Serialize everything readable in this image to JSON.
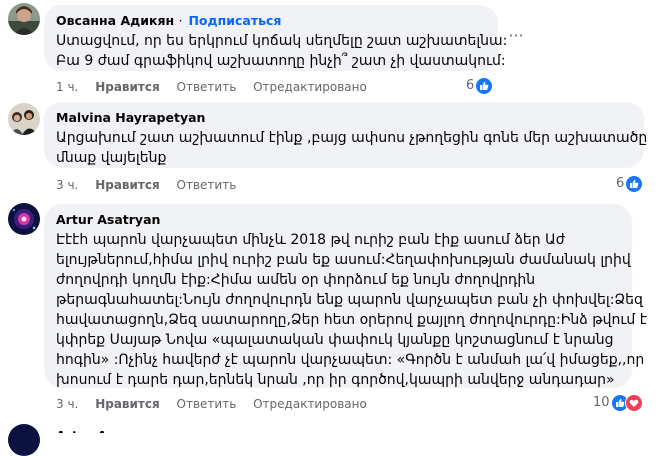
{
  "comments": [
    {
      "author": "Овсанна Адикян",
      "follow_label": "Подписаться",
      "lines": [
        "Ստացվում, որ ես երկրում կոճակ սեղմելը շատ աշխատելնա:",
        "Բա 9 ժամ գրաֆիկով աշխատողը ինչի՞ շատ չի վաստակում:"
      ],
      "time": "1 ч.",
      "like_label": "Нравится",
      "reply_label": "Ответить",
      "edited_label": "Отредактировано",
      "reaction_count": "6",
      "reactions": [
        "like-icon"
      ]
    },
    {
      "author": "Malvina Hayrapetyan",
      "lines": [
        "Արցախում շատ աշխատում էինք ,բայց ափսոս չթողեցին գոնե մեր աշխատածը",
        "մնաք վայելենք"
      ],
      "time": "3 ч.",
      "like_label": "Нравится",
      "reply_label": "Ответить",
      "reaction_count": "6",
      "reactions": [
        "like-icon"
      ]
    },
    {
      "author": "Artur Asatryan",
      "lines": [
        "Էէէհ պարոն վարչապետ մինչև 2018 թվ ուրիշ բան էիք ասում ձեր Աժ",
        "ելույթներում,հիմա լրիվ ուրիշ բան եք ասում:Հեղափոխության ժամանակ լրիվ",
        "ժողովրդի կողմն էիք:Հիմա ամեն օր փորձում եք նույն ժողովրդին",
        "թերագնահատել:Նույն ժողովուրդն ենք պարոն վարչապետ բան չի փոխվել:Ձեզ",
        "հավատացողն,Ձեզ սատարողը,Ձեր հետ օրերով քայլող ժողովուրդը:Ինձ թվում է",
        "կփրեք Սայաթ Նովա  «պալատական փափուկ կյանքը կոշտացնում է նրանց",
        "հոգին» :Ոչինչ հավերժ չէ պարոն վարչապետ: «Գործն է անմահ լա՛վ իմացեք,,որ",
        "խոսում է դարե դար,երնեկ նրան ,որ իր գործով,կապրի անվերջ անդադար»"
      ],
      "time": "3 ч.",
      "like_label": "Нравится",
      "reply_label": "Ответить",
      "edited_label": "Отредактировано",
      "reaction_count": "10",
      "reactions": [
        "like-icon",
        "heart-icon"
      ]
    }
  ],
  "next_author_partial": "Artur A..."
}
